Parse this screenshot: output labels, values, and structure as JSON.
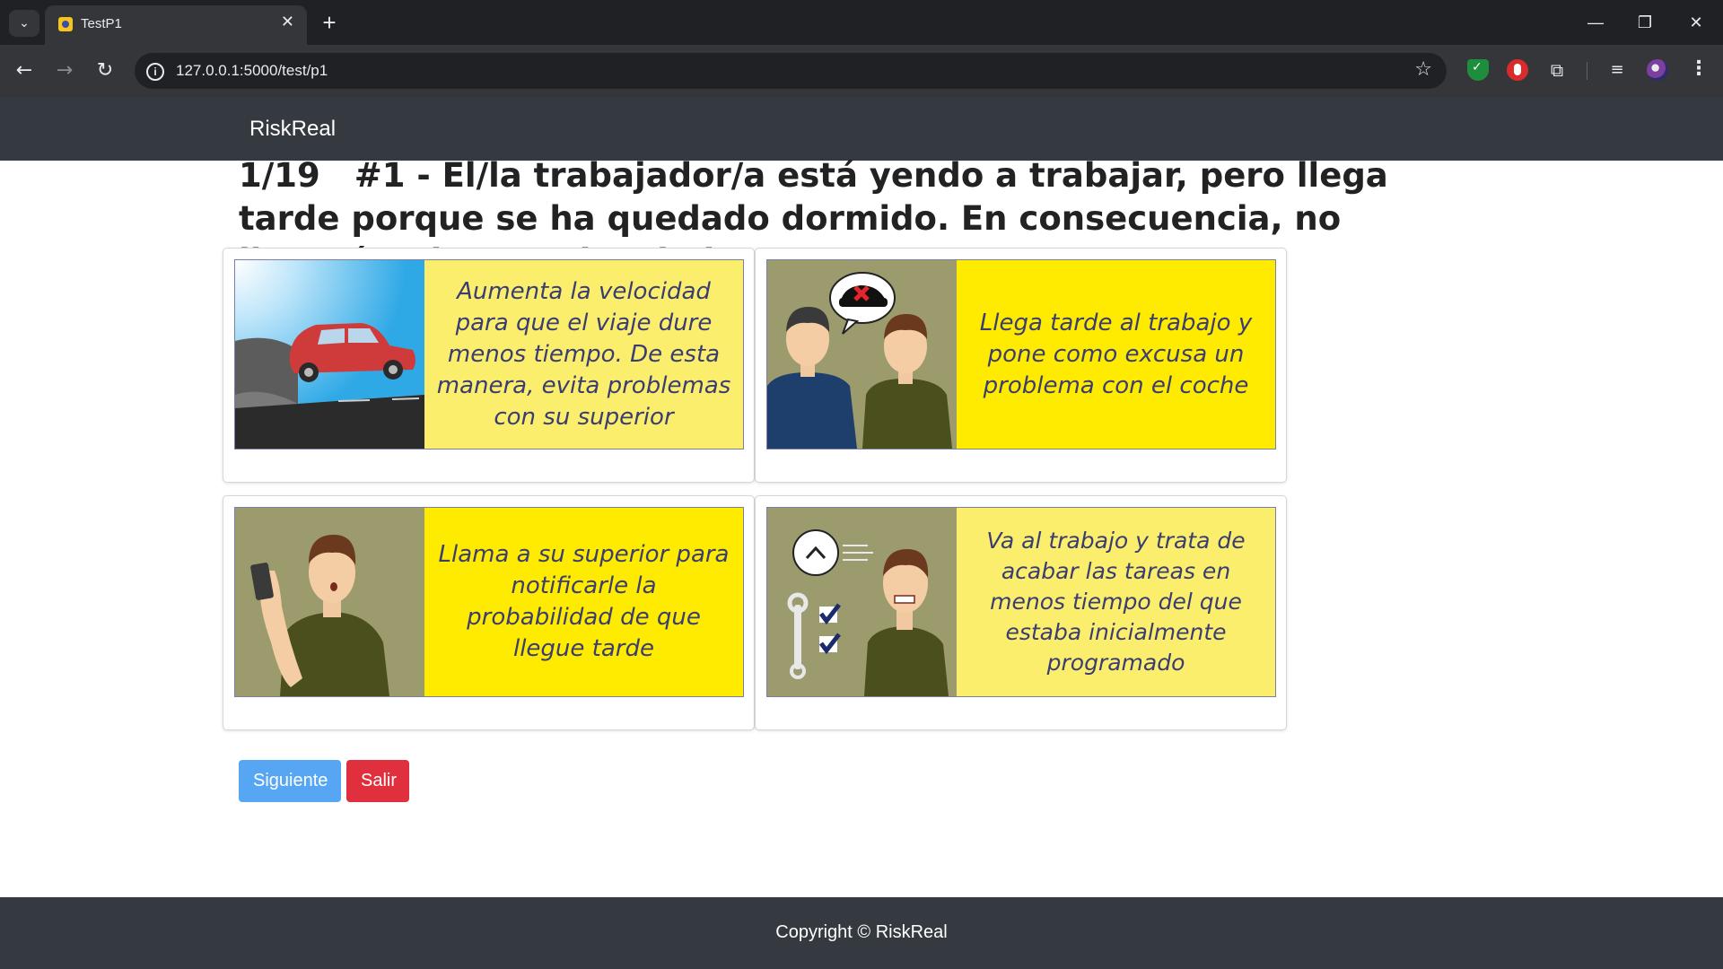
{
  "browser": {
    "tab_title": "TestP1",
    "tab_close": "✕",
    "new_tab": "+",
    "url": "127.0.0.1:5000/test/p1",
    "window_controls": {
      "minimize": "—",
      "restore": "❐",
      "close": "✕"
    },
    "nav": {
      "back": "←",
      "forward": "→",
      "reload": "↻"
    },
    "icons": [
      "search-tabs-icon",
      "favicon",
      "info-icon",
      "star-icon",
      "shield-extension-icon",
      "stop-extension-icon",
      "puzzle-extension-icon",
      "media-icon",
      "profile-avatar",
      "menu-icon"
    ]
  },
  "navbar": {
    "brand": "RiskReal"
  },
  "question": {
    "counter": "1/19",
    "text": "#1 - El/la trabajador/a está yendo a trabajar, pero llega tarde porque se ha quedado dormido. En consecuencia, no llegará a tiempo al trabajo."
  },
  "options": [
    {
      "text": "Aumenta la velocidad para que el viaje dure menos tiempo. De esta manera, evita problemas con su superior",
      "illustration": "red-car-driving"
    },
    {
      "text": "Llega tarde al trabajo y pone como excusa un problema con el coche",
      "illustration": "two-men-car-excuse"
    },
    {
      "text": "Llama a su superior para notificarle la probabilidad de que llegue tarde",
      "illustration": "man-holding-phone"
    },
    {
      "text": "Va al trabajo y trata de acabar las tareas en menos tiempo del que estaba inicialmente programado",
      "illustration": "stressed-man-clock-checklist"
    }
  ],
  "buttons": {
    "next": "Siguiente",
    "exit": "Salir"
  },
  "footer": {
    "copyright": "Copyright © RiskReal"
  },
  "colors": {
    "navbar": "#343a40",
    "option_yellow_light": "#fbee6d",
    "option_yellow": "#ffeb00",
    "option_text": "#3a3d72",
    "button_next": "#56a6f4",
    "button_exit": "#e02f3d"
  }
}
